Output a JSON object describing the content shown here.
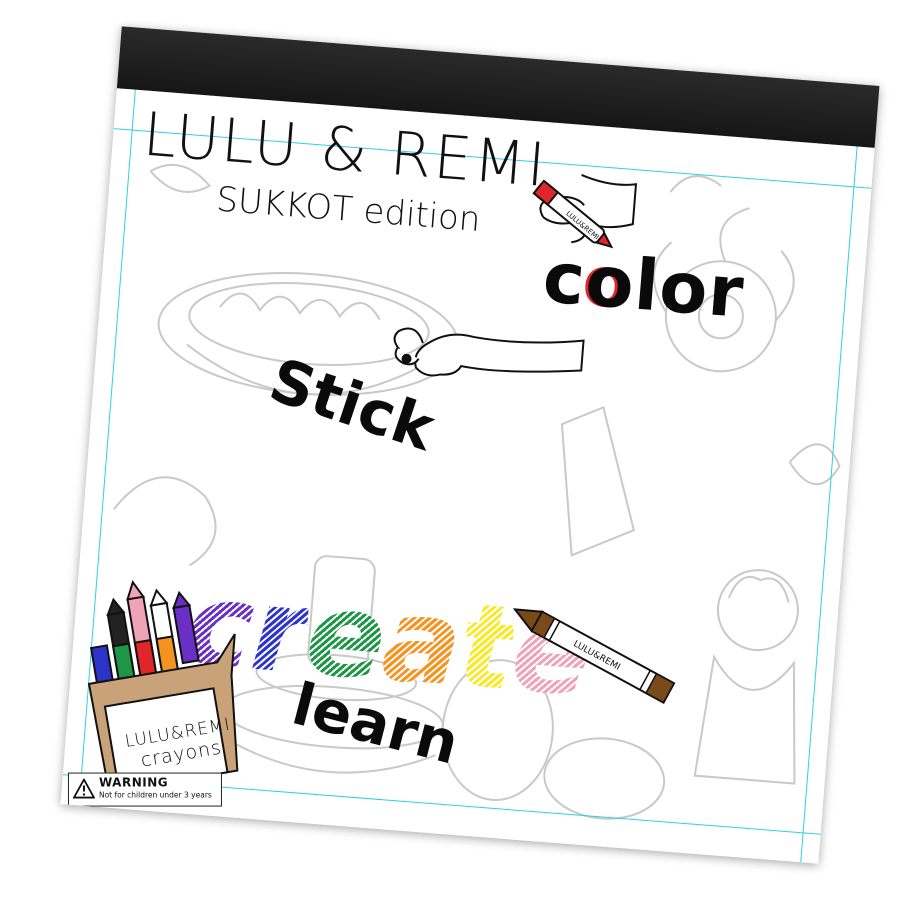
{
  "cover": {
    "title": "LULU & REMI",
    "subtitle": "SUKKOT edition",
    "words": {
      "color": "c",
      "color_o": "o",
      "color_rest": "lor",
      "stick": "Stick",
      "learn": "learn"
    },
    "create_letters": [
      "c",
      "r",
      "e",
      "a",
      "t",
      "e"
    ],
    "brand_on_crayon": "LULU&REMI",
    "colors": {
      "purple": "#6a2fc4",
      "blue": "#2b33c9",
      "green": "#1d9645",
      "orange": "#f39421",
      "yellow": "#f7e92a",
      "pink": "#f0a2b8",
      "brown_crayon": "#7a4a18",
      "red_marker": "#e0262a",
      "guide_cyan": "#31d0e0"
    }
  },
  "crayon_box": {
    "brand": "LULU&REMI",
    "product": "crayons",
    "crayon_labels": [
      "BLACK",
      "PINK",
      "WHITE",
      "BLUE",
      "GREEN",
      "RED",
      "ORANGE",
      "PURPLE"
    ]
  },
  "warning": {
    "title": "WARNING",
    "text": "Not for children under 3 years"
  },
  "icons": [
    "hand-with-marker-icon",
    "hand-pointing-icon",
    "crayon-icon",
    "warning-triangle-icon"
  ]
}
